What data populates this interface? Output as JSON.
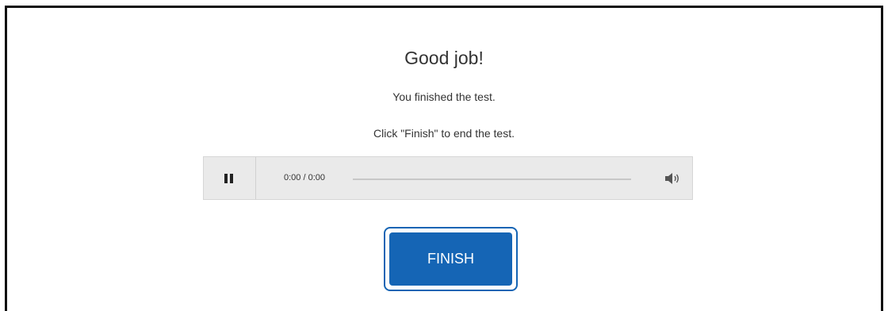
{
  "page": {
    "heading": "Good job!",
    "message_1": "You finished the test.",
    "message_2": "Click \"Finish\" to end the test."
  },
  "audio_player": {
    "time_display": "0:00 / 0:00",
    "play_state": "pause",
    "progress": 0
  },
  "finish_button": {
    "label": "FINISH"
  },
  "colors": {
    "accent": "#1565b5",
    "player_bg": "#eaeaea",
    "text": "#333333"
  },
  "icons": {
    "pause": "pause-icon",
    "volume": "volume-icon"
  }
}
